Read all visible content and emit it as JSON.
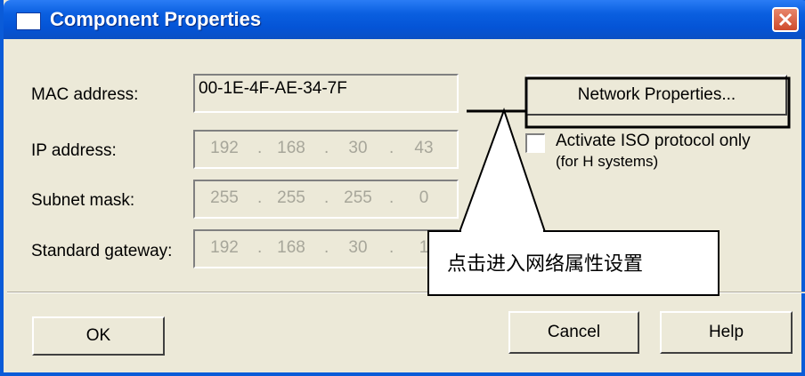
{
  "window": {
    "title": "Component Properties"
  },
  "labels": {
    "mac": "MAC address:",
    "ip": "IP address:",
    "subnet": "Subnet mask:",
    "gateway": "Standard gateway:"
  },
  "values": {
    "mac": "00-1E-4F-AE-34-7F",
    "ip": [
      "192",
      "168",
      "30",
      "43"
    ],
    "subnet": [
      "255",
      "255",
      "255",
      "0"
    ],
    "gateway": [
      "192",
      "168",
      "30",
      "1"
    ]
  },
  "buttons": {
    "network_properties": "Network Properties...",
    "ok": "OK",
    "cancel": "Cancel",
    "help": "Help"
  },
  "checkbox": {
    "line1": "Activate ISO protocol only",
    "line2": "(for H systems)",
    "checked": false
  },
  "callout": {
    "text": "点击进入网络属性设置"
  },
  "colors": {
    "title_blue": "#0454d6",
    "dialog_bg": "#ece9d8",
    "close_red": "#cf4a2c"
  },
  "icons": [
    "window-icon",
    "close-icon"
  ]
}
